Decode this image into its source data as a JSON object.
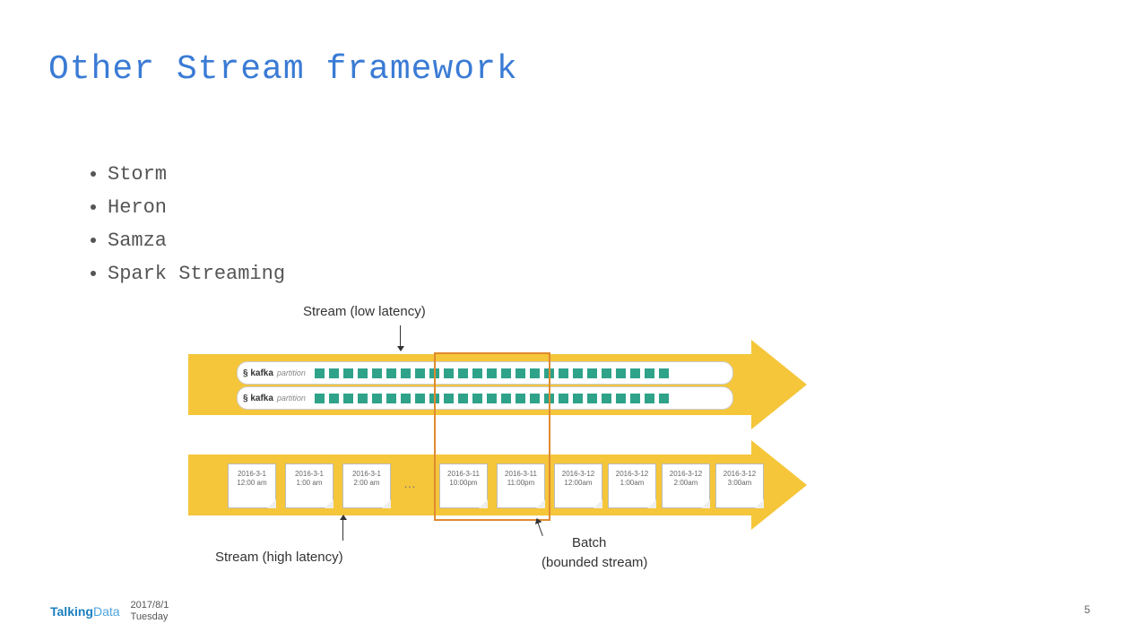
{
  "title": "Other Stream framework",
  "bullets": [
    "Storm",
    "Heron",
    "Samza",
    "Spark Streaming"
  ],
  "diagram": {
    "stream_low_label": "Stream (low latency)",
    "stream_high_label": "Stream (high latency)",
    "batch_label_line1": "Batch",
    "batch_label_line2": "(bounded stream)",
    "kafka_text": "kafka",
    "partition_text": "partition",
    "dots": "…",
    "cards": [
      {
        "d": "2016-3-1",
        "t": "12:00 am"
      },
      {
        "d": "2016-3-1",
        "t": "1:00 am"
      },
      {
        "d": "2016-3-1",
        "t": "2:00 am"
      },
      {
        "d": "2016-3-11",
        "t": "10:00pm"
      },
      {
        "d": "2016-3-11",
        "t": "11:00pm"
      },
      {
        "d": "2016-3-12",
        "t": "12:00am"
      },
      {
        "d": "2016-3-12",
        "t": "1:00am"
      },
      {
        "d": "2016-3-12",
        "t": "2:00am"
      },
      {
        "d": "2016-3-12",
        "t": "3:00am"
      }
    ]
  },
  "footer": {
    "brand1": "Talking",
    "brand2": "Data",
    "date": "2017/8/1",
    "day": "Tuesday"
  },
  "page": "5"
}
